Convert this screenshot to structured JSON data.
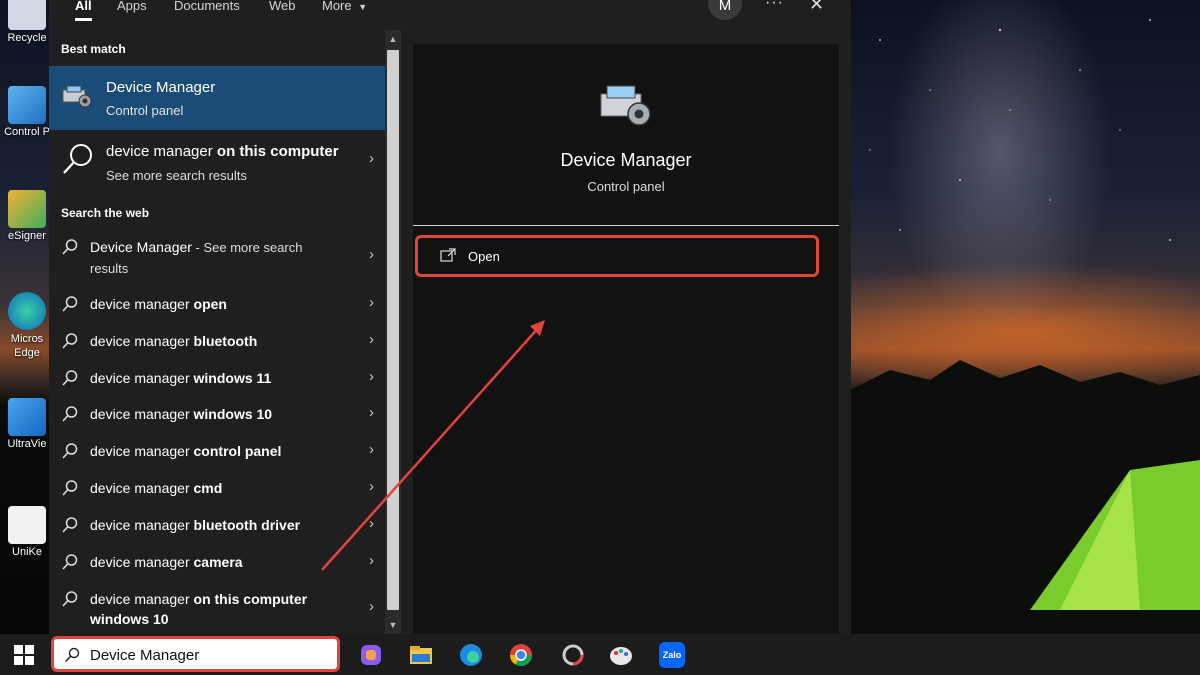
{
  "desktop": {
    "icons": [
      {
        "label": "Recycle"
      },
      {
        "label": "Control P"
      },
      {
        "label": "eSigner"
      },
      {
        "label": "Micros Edge"
      },
      {
        "label": "UltraVie"
      },
      {
        "label": "UniKe"
      }
    ]
  },
  "search": {
    "tabs": [
      "All",
      "Apps",
      "Documents",
      "Web",
      "More"
    ],
    "avatar_initial": "M",
    "menu_glyph": "···",
    "close_glyph": "✕",
    "best_match_header": "Best match",
    "best_match": {
      "title": "Device Manager",
      "subtitle": "Control panel"
    },
    "local_result": {
      "query": "device manager",
      "suffix": "on this computer",
      "subtitle": "See more search results"
    },
    "web_header": "Search the web",
    "web_first": {
      "query": "Device Manager",
      "suffix": " - See more search results"
    },
    "web_results": [
      {
        "prefix": "device manager ",
        "bold": "open"
      },
      {
        "prefix": "device manager ",
        "bold": "bluetooth"
      },
      {
        "prefix": "device manager ",
        "bold": "windows 11"
      },
      {
        "prefix": "device manager ",
        "bold": "windows 10"
      },
      {
        "prefix": "device manager ",
        "bold": "control panel"
      },
      {
        "prefix": "device manager ",
        "bold": "cmd"
      },
      {
        "prefix": "device manager ",
        "bold": "bluetooth driver"
      },
      {
        "prefix": "device manager ",
        "bold": "camera"
      }
    ],
    "web_last": {
      "prefix": "device manager ",
      "bold1": "on this computer",
      "bold2": "windows 10"
    },
    "chevron": "›"
  },
  "preview": {
    "title": "Device Manager",
    "subtitle": "Control panel",
    "open_label": "Open"
  },
  "taskbar": {
    "search_value": "Device Manager",
    "apps": [
      "copilot-icon",
      "file-explorer-icon",
      "edge-icon",
      "chrome-icon",
      "app-ring-icon",
      "paint-icon",
      "zalo-icon"
    ],
    "zalo_label": "Zalo"
  },
  "colors": {
    "highlight": "#1b4c78",
    "annotation_red": "#e0443a"
  }
}
